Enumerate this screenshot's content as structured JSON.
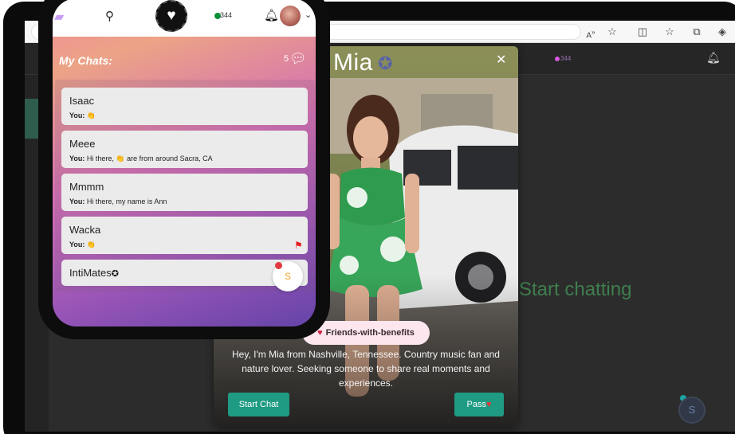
{
  "browser": {
    "icons": [
      "read-aloud-icon",
      "favorite-star-icon",
      "split-screen-icon",
      "favorites-list-icon",
      "collections-icon",
      "copilot-icon"
    ]
  },
  "site_header": {
    "online_count": "344"
  },
  "main": {
    "empty_prompt": "Start chatting"
  },
  "profile_card": {
    "name": "Mia",
    "relationship_tag": "Friends-with-benefits",
    "bio": "Hey, I'm Mia from Nashville, Tennessee. Country music fan and nature lover. Seeking someone to share real moments and experiences.",
    "start_chat_label": "Start Chat",
    "pass_label": "Pass"
  },
  "phone": {
    "online_count": "344",
    "chats_title": "My Chats:",
    "chats_count": "5",
    "fab_label": "S",
    "chats": [
      {
        "name": "Isaac",
        "sender": "You:",
        "message": "👏",
        "flagged": false,
        "verified": false
      },
      {
        "name": "Meee",
        "sender": "You:",
        "message": "Hi there, 👏 are from around Sacra, CA",
        "flagged": false,
        "verified": false
      },
      {
        "name": "Mmmm",
        "sender": "You:",
        "message": "Hi there, my name is Ann",
        "flagged": false,
        "verified": false
      },
      {
        "name": "Wacka",
        "sender": "You:",
        "message": "👏",
        "flagged": true,
        "verified": false
      },
      {
        "name": "IntiMates",
        "sender": "",
        "message": "",
        "flagged": true,
        "verified": true
      }
    ]
  },
  "colors": {
    "accent_teal": "#1f9b83",
    "flag_red": "#e6201f",
    "online_green": "#0b8d3a"
  }
}
